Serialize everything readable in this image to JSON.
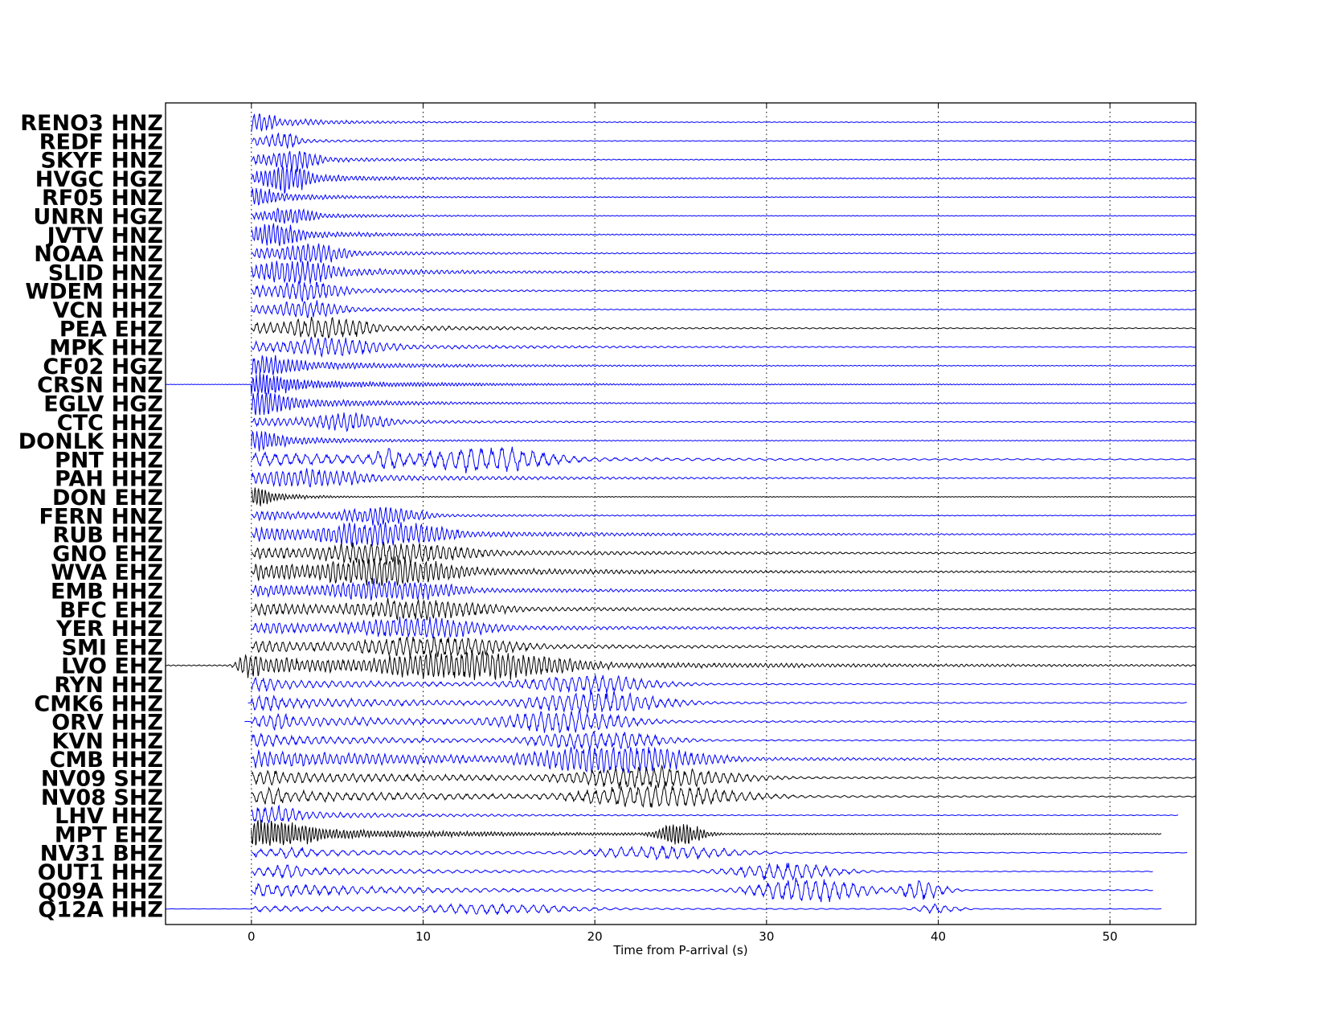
{
  "chart_data": {
    "type": "line",
    "xlabel": "Time from P-arrival (s)",
    "xlim": [
      -5,
      55
    ],
    "xticks": [
      0,
      10,
      20,
      30,
      40,
      50
    ],
    "grid": "vertical dotted",
    "colors": {
      "HN_HH_HG_BH": "#0000ff",
      "EH_SH": "#000000"
    },
    "series": [
      {
        "name": "RENO3 HNZ",
        "color": "#0000ff",
        "start": 0.0,
        "end": 55.0,
        "peak": 0.3,
        "amp": 0.6,
        "coda": 2.5,
        "period": 0.3,
        "burst2": null
      },
      {
        "name": "REDF HHZ",
        "color": "#0000ff",
        "start": 0.0,
        "end": 55.0,
        "peak": 1.8,
        "amp": 0.5,
        "coda": 2.0,
        "period": 0.35,
        "burst2": null
      },
      {
        "name": "SKYF HNZ",
        "color": "#0000ff",
        "start": 0.0,
        "end": 55.0,
        "peak": 2.5,
        "amp": 0.6,
        "coda": 3.0,
        "period": 0.3,
        "burst2": null
      },
      {
        "name": "HVGC HGZ",
        "color": "#0000ff",
        "start": 0.0,
        "end": 55.0,
        "peak": 2.0,
        "amp": 0.8,
        "coda": 3.0,
        "period": 0.25,
        "burst2": null
      },
      {
        "name": "RF05 HNZ",
        "color": "#0000ff",
        "start": 0.0,
        "end": 55.0,
        "peak": 0.5,
        "amp": 0.5,
        "coda": 3.0,
        "period": 0.25,
        "burst2": null
      },
      {
        "name": "UNRN HGZ",
        "color": "#0000ff",
        "start": 0.0,
        "end": 55.0,
        "peak": 2.2,
        "amp": 0.5,
        "coda": 3.0,
        "period": 0.25,
        "burst2": null
      },
      {
        "name": "JVTV HNZ",
        "color": "#0000ff",
        "start": 0.0,
        "end": 55.0,
        "peak": 1.5,
        "amp": 0.7,
        "coda": 3.0,
        "period": 0.25,
        "burst2": null
      },
      {
        "name": "NOAA HNZ",
        "color": "#0000ff",
        "start": 0.0,
        "end": 55.0,
        "peak": 3.5,
        "amp": 0.6,
        "coda": 4.0,
        "period": 0.3,
        "burst2": null
      },
      {
        "name": "SLID HNZ",
        "color": "#0000ff",
        "start": 0.0,
        "end": 55.0,
        "peak": 2.5,
        "amp": 0.7,
        "coda": 5.0,
        "period": 0.3,
        "burst2": null
      },
      {
        "name": "WDEM HHZ",
        "color": "#0000ff",
        "start": 0.0,
        "end": 55.0,
        "peak": 3.2,
        "amp": 0.6,
        "coda": 4.0,
        "period": 0.35,
        "burst2": null
      },
      {
        "name": "VCN HHZ",
        "color": "#0000ff",
        "start": 0.0,
        "end": 55.0,
        "peak": 3.3,
        "amp": 0.5,
        "coda": 4.0,
        "period": 0.35,
        "burst2": null
      },
      {
        "name": "PEA EHZ",
        "color": "#000000",
        "start": 0.0,
        "end": 55.0,
        "peak": 4.3,
        "amp": 0.6,
        "coda": 6.0,
        "period": 0.4,
        "burst2": null
      },
      {
        "name": "MPK HHZ",
        "color": "#0000ff",
        "start": 0.0,
        "end": 55.0,
        "peak": 4.5,
        "amp": 0.5,
        "coda": 7.0,
        "period": 0.4,
        "burst2": null
      },
      {
        "name": "CF02 HGZ",
        "color": "#0000ff",
        "start": 0.0,
        "end": 55.0,
        "peak": 0.5,
        "amp": 0.6,
        "coda": 5.0,
        "period": 0.25,
        "burst2": null
      },
      {
        "name": "CRSN HNZ",
        "color": "#0000ff",
        "start": -5.0,
        "end": 55.0,
        "peak": 0.3,
        "amp": 0.6,
        "coda": 5.0,
        "period": 0.2,
        "burst2": null
      },
      {
        "name": "EGLV HGZ",
        "color": "#0000ff",
        "start": 0.0,
        "end": 55.0,
        "peak": 0.5,
        "amp": 0.7,
        "coda": 4.0,
        "period": 0.25,
        "burst2": null
      },
      {
        "name": "CTC HHZ",
        "color": "#0000ff",
        "start": 0.0,
        "end": 55.0,
        "peak": 5.5,
        "amp": 0.5,
        "coda": 5.0,
        "period": 0.35,
        "burst2": null
      },
      {
        "name": "DONLK HNZ",
        "color": "#0000ff",
        "start": 0.0,
        "end": 55.0,
        "peak": 0.5,
        "amp": 0.6,
        "coda": 3.0,
        "period": 0.25,
        "burst2": null
      },
      {
        "name": "PNT HHZ",
        "color": "#0000ff",
        "start": 0.0,
        "end": 55.0,
        "peak": 13.5,
        "amp": 0.7,
        "coda": 8.0,
        "period": 0.6,
        "burst2": 8.0
      },
      {
        "name": "PAH HHZ",
        "color": "#0000ff",
        "start": 0.0,
        "end": 55.0,
        "peak": 3.0,
        "amp": 0.5,
        "coda": 8.0,
        "period": 0.35,
        "burst2": null
      },
      {
        "name": "DON EHZ",
        "color": "#000000",
        "start": 0.0,
        "end": 55.0,
        "peak": 0.4,
        "amp": 0.6,
        "coda": 1.5,
        "period": 0.2,
        "burst2": null
      },
      {
        "name": "FERN HNZ",
        "color": "#0000ff",
        "start": 0.0,
        "end": 55.0,
        "peak": 7.5,
        "amp": 0.5,
        "coda": 5.0,
        "period": 0.3,
        "burst2": null
      },
      {
        "name": "RUB HHZ",
        "color": "#0000ff",
        "start": 0.0,
        "end": 55.0,
        "peak": 7.5,
        "amp": 0.7,
        "coda": 8.0,
        "period": 0.3,
        "burst2": null
      },
      {
        "name": "GNO EHZ",
        "color": "#000000",
        "start": 0.0,
        "end": 55.0,
        "peak": 8.0,
        "amp": 0.6,
        "coda": 10.0,
        "period": 0.35,
        "burst2": null
      },
      {
        "name": "WVA EHZ",
        "color": "#000000",
        "start": 0.0,
        "end": 55.0,
        "peak": 7.5,
        "amp": 0.8,
        "coda": 9.0,
        "period": 0.3,
        "burst2": null
      },
      {
        "name": "EMB HHZ",
        "color": "#0000ff",
        "start": 0.0,
        "end": 55.0,
        "peak": 8.0,
        "amp": 0.6,
        "coda": 8.0,
        "period": 0.3,
        "burst2": null
      },
      {
        "name": "BFC EHZ",
        "color": "#000000",
        "start": 0.0,
        "end": 55.0,
        "peak": 9.5,
        "amp": 0.6,
        "coda": 9.0,
        "period": 0.35,
        "burst2": null
      },
      {
        "name": "YER HHZ",
        "color": "#0000ff",
        "start": 0.0,
        "end": 55.0,
        "peak": 9.5,
        "amp": 0.6,
        "coda": 9.0,
        "period": 0.35,
        "burst2": null
      },
      {
        "name": "SMI EHZ",
        "color": "#000000",
        "start": 0.0,
        "end": 55.0,
        "peak": 10.5,
        "amp": 0.6,
        "coda": 10.0,
        "period": 0.4,
        "burst2": null
      },
      {
        "name": "LVO EHZ",
        "color": "#000000",
        "start": -5.0,
        "end": 55.0,
        "peak": 12.5,
        "amp": 0.8,
        "coda": 12.0,
        "period": 0.3,
        "burst2": -0.2
      },
      {
        "name": "RYN HHZ",
        "color": "#0000ff",
        "start": 0.0,
        "end": 55.0,
        "peak": 19.5,
        "amp": 0.5,
        "coda": 8.0,
        "period": 0.45,
        "burst2": 0.6
      },
      {
        "name": "CMK6 HHZ",
        "color": "#0000ff",
        "start": -0.2,
        "end": 54.5,
        "peak": 20.0,
        "amp": 0.6,
        "coda": 8.0,
        "period": 0.45,
        "burst2": 0.8
      },
      {
        "name": "ORV HHZ",
        "color": "#0000ff",
        "start": -0.4,
        "end": 55.0,
        "peak": 18.0,
        "amp": 0.6,
        "coda": 8.0,
        "period": 0.45,
        "burst2": 1.5
      },
      {
        "name": "KVN HHZ",
        "color": "#0000ff",
        "start": 0.0,
        "end": 55.0,
        "peak": 20.0,
        "amp": 0.5,
        "coda": 8.0,
        "period": 0.45,
        "burst2": 0.6
      },
      {
        "name": "CMB HHZ",
        "color": "#0000ff",
        "start": 0.0,
        "end": 55.0,
        "peak": 21.0,
        "amp": 0.8,
        "coda": 10.0,
        "period": 0.35,
        "burst2": null
      },
      {
        "name": "NV09 SHZ",
        "color": "#000000",
        "start": 0.0,
        "end": 55.0,
        "peak": 23.0,
        "amp": 0.6,
        "coda": 10.0,
        "period": 0.45,
        "burst2": 1.0
      },
      {
        "name": "NV08 SHZ",
        "color": "#000000",
        "start": 0.0,
        "end": 55.0,
        "peak": 23.5,
        "amp": 0.6,
        "coda": 10.0,
        "period": 0.5,
        "burst2": 1.2
      },
      {
        "name": "LHV HHZ",
        "color": "#0000ff",
        "start": 0.0,
        "end": 54.0,
        "peak": 0.8,
        "amp": 0.5,
        "coda": 5.0,
        "period": 0.4,
        "burst2": null
      },
      {
        "name": "MPT EHZ",
        "color": "#000000",
        "start": 0.0,
        "end": 53.0,
        "peak": 1.0,
        "amp": 0.8,
        "coda": 6.0,
        "period": 0.2,
        "burst2": 25.0
      },
      {
        "name": "NV31 BHZ",
        "color": "#0000ff",
        "start": 0.0,
        "end": 54.5,
        "peak": 24.0,
        "amp": 0.4,
        "coda": 8.0,
        "period": 0.6,
        "burst2": 2.5
      },
      {
        "name": "OUT1 HHZ",
        "color": "#0000ff",
        "start": 0.0,
        "end": 52.5,
        "peak": 31.0,
        "amp": 0.5,
        "coda": 6.0,
        "period": 0.55,
        "burst2": 2.0
      },
      {
        "name": "Q09A HHZ",
        "color": "#0000ff",
        "start": 0.0,
        "end": 52.5,
        "peak": 32.5,
        "amp": 0.7,
        "coda": 6.0,
        "period": 0.55,
        "burst2": 39.0
      },
      {
        "name": "Q12A HHZ",
        "color": "#0000ff",
        "start": -5.0,
        "end": 53.0,
        "peak": 14.0,
        "amp": 0.3,
        "coda": 10.0,
        "period": 0.6,
        "burst2": 40.0
      }
    ]
  }
}
